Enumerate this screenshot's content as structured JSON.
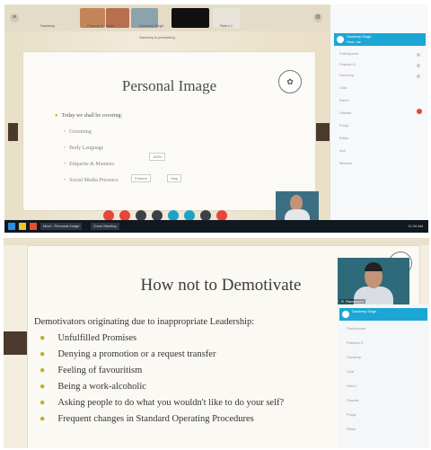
{
  "top": {
    "participants": [
      {
        "label": "Sandeep",
        "color": "#c4845a"
      },
      {
        "label": "Prakash K. Shah",
        "color": "#b86f4f"
      },
      {
        "label": "Sandeep Singh",
        "color": "#8ca2ad"
      },
      {
        "label": "",
        "color": "#111111"
      },
      {
        "label": "Rahul J",
        "color": "#e8e4dc"
      }
    ],
    "presenting_label": "Sandeep is presenting",
    "slide_title": "Personal Image",
    "intro_bullet": "Today we shall be covering:",
    "sub_bullets": [
      "Grooming",
      "Body Language",
      "Etiquette & Manners",
      "Social Media Presence"
    ],
    "zoom_label": "100%",
    "present_buttons": [
      "Present",
      "Stop"
    ],
    "panel": {
      "host_name": "Sandeep Singh",
      "host_sub": "Host, me",
      "rows": [
        "Participants",
        "Prakash K.",
        "Sandeep",
        "Chat",
        "Rahul",
        "Shweta",
        "Pooja",
        "Ritika",
        "Anil",
        "Mahesh"
      ]
    },
    "taskbar": {
      "tabs": [
        "Meet - Personal Image",
        "Zoom Meeting"
      ],
      "clock": "11:34 AM"
    },
    "colors": {
      "control_red": "#e9443a",
      "control_dark": "#3c4046",
      "control_teal": "#1aa3c7",
      "accent": "#1ca6d4"
    }
  },
  "bottom": {
    "slide_title": "How not to Demotivate",
    "intro": "Demotivators originating due to inappropriate Leadership:",
    "bullets": [
      "Unfulfilled Promises",
      "Denying a promotion or a request transfer",
      "Feeling of favouritism",
      "Being a work-alcoholic",
      "Asking people to do what you wouldn't like to do your self?",
      "Frequent changes in Standard Operating Procedures"
    ],
    "webcam_name": "R. Ramamurti",
    "panel": {
      "host_name": "Sandeep Singh",
      "rows": [
        "Participants",
        "Prakash K.",
        "Sandeep",
        "Chat",
        "Rahul",
        "Shweta",
        "Pooja",
        "Ritika"
      ]
    }
  }
}
